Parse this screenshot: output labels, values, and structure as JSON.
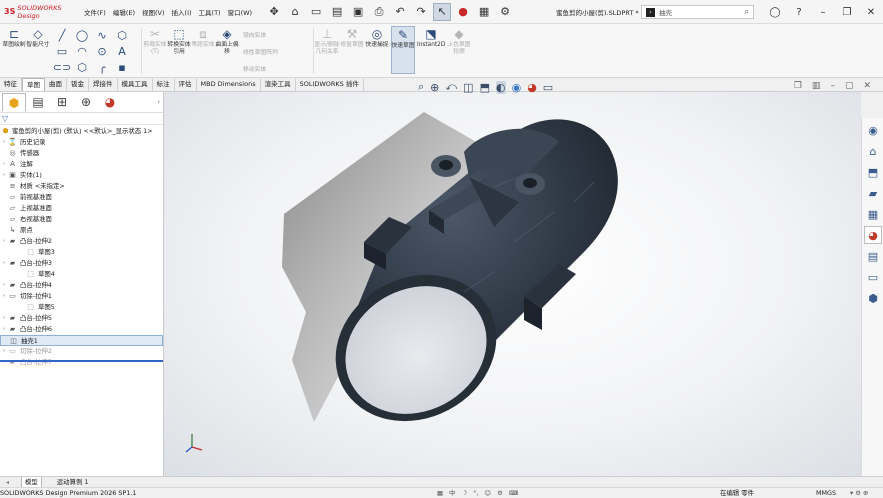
{
  "app": {
    "brand_prefix": "3S",
    "brand_name": "SOLIDWORKS Design",
    "document_title": "蜜鱼剪的小屋(剪).SLDPRT *"
  },
  "menu": [
    "文件(F)",
    "编辑(E)",
    "视图(V)",
    "插入(I)",
    "工具(T)",
    "窗口(W)"
  ],
  "search": {
    "placeholder": "抽壳"
  },
  "ribbon": {
    "sketch": "草图绘制",
    "smart_dim": "智能尺寸",
    "trim": "剪裁实体(T)",
    "convert": "转换实体引用",
    "offset": "等距实体",
    "surface_offset": "曲面上偏移",
    "mirror": "镜向实体",
    "linear_pattern": "线性草图阵列",
    "move": "移动实体",
    "display_relations": "显示/删除几何关系",
    "repair": "修复草图",
    "quick_snap": "快速捕捉",
    "rapid_sketch": "快速草图",
    "instant2d": "Instant2D",
    "shaded_sketch": "上色草图轮廓"
  },
  "tabs": [
    "特征",
    "草图",
    "曲面",
    "钣金",
    "焊接件",
    "模具工具",
    "标注",
    "评估",
    "MBD Dimensions",
    "渲染工具",
    "SOLIDWORKS 插件"
  ],
  "active_tab": "草图",
  "feature_tree": {
    "root": "蜜鱼剪的小屋(剪) (默认) <<默认>_显示状态 1>",
    "items": [
      {
        "label": "历史记录",
        "level": 0,
        "expand": true,
        "icon": "history-icon"
      },
      {
        "label": "传感器",
        "level": 0,
        "expand": false,
        "icon": "sensor-icon"
      },
      {
        "label": "注解",
        "level": 0,
        "expand": true,
        "icon": "annotation-icon"
      },
      {
        "label": "实体(1)",
        "level": 0,
        "expand": true,
        "icon": "solid-bodies-icon"
      },
      {
        "label": "材质 <未指定>",
        "level": 0,
        "expand": false,
        "icon": "material-icon"
      },
      {
        "label": "前视基准面",
        "level": 0,
        "expand": false,
        "icon": "plane-icon"
      },
      {
        "label": "上视基准面",
        "level": 0,
        "expand": false,
        "icon": "plane-icon"
      },
      {
        "label": "右视基准面",
        "level": 0,
        "expand": false,
        "icon": "plane-icon"
      },
      {
        "label": "原点",
        "level": 0,
        "expand": false,
        "icon": "origin-icon"
      },
      {
        "label": "凸台-拉伸2",
        "level": 0,
        "expand": true,
        "icon": "boss-extrude-icon"
      },
      {
        "label": "草图3",
        "level": 1,
        "expand": false,
        "icon": "sketch-icon"
      },
      {
        "label": "凸台-拉伸3",
        "level": 0,
        "expand": true,
        "icon": "boss-extrude-icon"
      },
      {
        "label": "草图4",
        "level": 1,
        "expand": false,
        "icon": "sketch-icon"
      },
      {
        "label": "凸台-拉伸4",
        "level": 0,
        "expand": true,
        "icon": "boss-extrude-icon"
      },
      {
        "label": "切除-拉伸1",
        "level": 0,
        "expand": true,
        "icon": "cut-extrude-icon"
      },
      {
        "label": "草图5",
        "level": 1,
        "expand": false,
        "icon": "sketch-icon"
      },
      {
        "label": "凸台-拉伸5",
        "level": 0,
        "expand": true,
        "icon": "boss-extrude-icon"
      },
      {
        "label": "凸台-拉伸6",
        "level": 0,
        "expand": true,
        "icon": "boss-extrude-icon"
      },
      {
        "label": "抽壳1",
        "level": 0,
        "expand": false,
        "icon": "shell-icon",
        "selected": true
      },
      {
        "label": "切除-拉伸2",
        "level": 0,
        "expand": true,
        "icon": "cut-extrude-icon",
        "dim": true
      },
      {
        "label": "凸台-拉伸7",
        "level": 0,
        "expand": true,
        "icon": "boss-extrude-icon",
        "dim": true
      }
    ]
  },
  "bottom_tabs": [
    "模型",
    "运动算例 1"
  ],
  "status": {
    "product": "SOLIDWORKS Design Premium 2026 SP1.1",
    "mode": "在编辑 零件",
    "units": "MMGS"
  },
  "colors": {
    "brand": "#d0202a",
    "model_body": "#2e3744",
    "selection": "#2f66c8"
  }
}
